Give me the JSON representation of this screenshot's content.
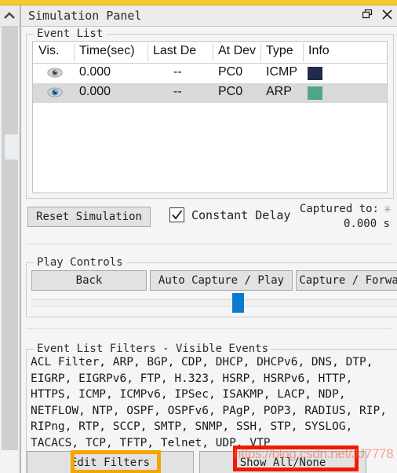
{
  "window": {
    "title": "Simulation Panel",
    "restore_label": "restore",
    "close_label": "close"
  },
  "event_list": {
    "group_label": "Event List",
    "columns": [
      "Vis.",
      "Time(sec)",
      "Last De",
      "At Dev",
      "Type",
      "Info"
    ],
    "rows": [
      {
        "vis": "eye-icon",
        "time": "0.000",
        "last_device": "--",
        "at_device": "PC0",
        "type": "ICMP",
        "info_color": "#1f2a4d",
        "selected": false
      },
      {
        "vis": "eye-icon",
        "time": "0.000",
        "last_device": "--",
        "at_device": "PC0",
        "type": "ARP",
        "info_color": "#52a488",
        "selected": true
      }
    ]
  },
  "controls": {
    "reset_label": "Reset Simulation",
    "constant_delay_label": "Constant Delay",
    "constant_delay_checked": true,
    "captured_to_label": "Captured to:",
    "captured_to_value": "0.000 s",
    "asterisk": "✳"
  },
  "play_controls": {
    "group_label": "Play Controls",
    "back_label": "Back",
    "auto_label": "Auto Capture / Play",
    "forward_label": "Capture / Forward",
    "slider_value": 50
  },
  "filters": {
    "group_label": "Event List Filters - Visible Events",
    "protocol_lines": [
      "ACL Filter, ARP, BGP, CDP, DHCP, DHCPv6, DNS, DTP,",
      "EIGRP, EIGRPv6, FTP, H.323, HSRP, HSRPv6, HTTP,",
      "HTTPS, ICMP, ICMPv6, IPSec, ISAKMP, LACP, NDP,",
      "NETFLOW, NTP, OSPF, OSPFv6, PAgP, POP3, RADIUS, RIP,",
      "RIPng, RTP, SCCP, SMTP, SNMP, SSH, STP, SYSLOG,",
      "TACACS, TCP, TFTP, Telnet, UDP, VTP"
    ],
    "edit_filters_label": "Edit Filters",
    "show_all_none_label": "Show All/None",
    "highlight_orange": "#f5a400",
    "highlight_red": "#f51800"
  },
  "watermark": {
    "text": "https://blog.csdn.net/JJ7778"
  }
}
